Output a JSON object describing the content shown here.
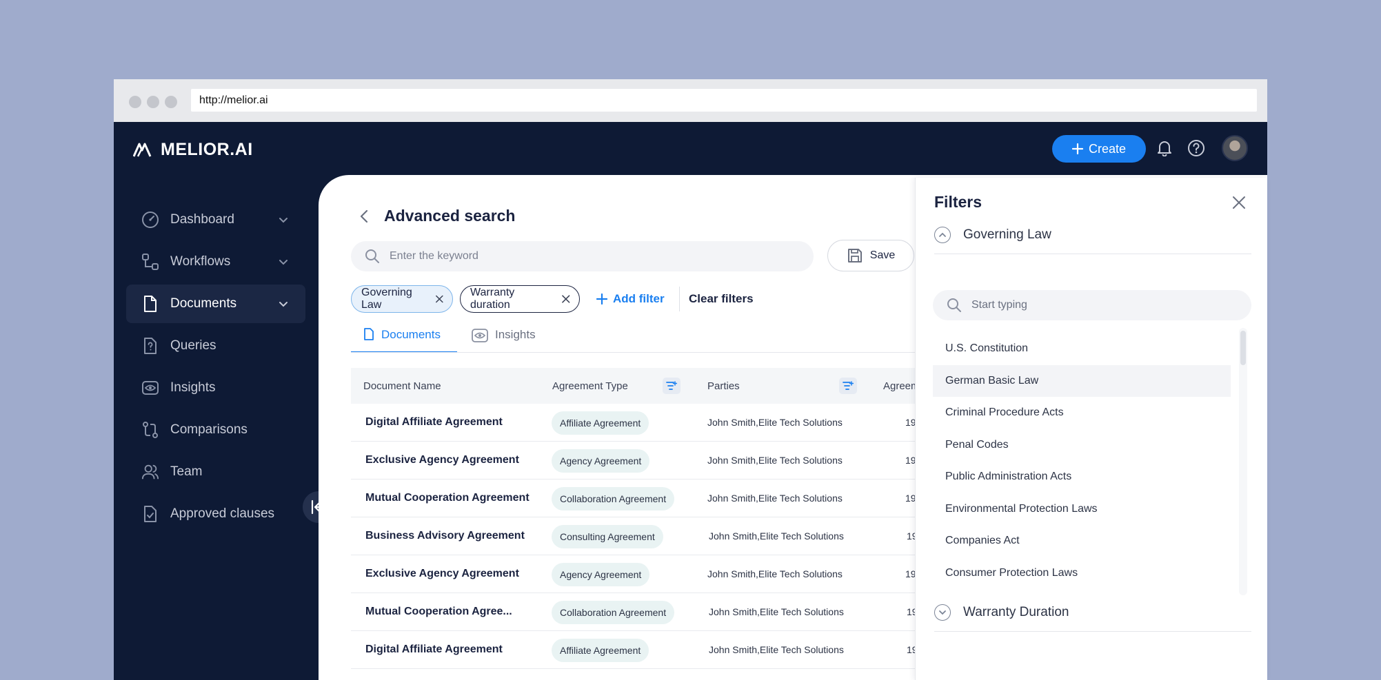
{
  "browser": {
    "url": "http://melior.ai"
  },
  "app": {
    "logo_text": "MELIOR.AI",
    "create_label": "Create"
  },
  "sidebar": {
    "items": [
      {
        "label": "Dashboard",
        "icon": "gauge-icon",
        "has_chevron": true
      },
      {
        "label": "Workflows",
        "icon": "workflow-icon",
        "has_chevron": true
      },
      {
        "label": "Documents",
        "icon": "document-icon",
        "has_chevron": true,
        "active": true
      },
      {
        "label": "Queries",
        "icon": "query-icon"
      },
      {
        "label": "Insights",
        "icon": "eye-icon"
      },
      {
        "label": "Comparisons",
        "icon": "compare-icon"
      },
      {
        "label": "Team",
        "icon": "team-icon"
      },
      {
        "label": "Approved clauses",
        "icon": "approved-doc-icon"
      }
    ]
  },
  "main": {
    "title": "Advanced search",
    "search_placeholder": "Enter the keyword",
    "save_label": "Save",
    "chips": [
      "Governing Law",
      "Warranty duration"
    ],
    "add_filter_label": "Add filter",
    "clear_filters_label": "Clear filters",
    "tabs": [
      {
        "label": "Documents",
        "active": true
      },
      {
        "label": "Insights",
        "active": false
      }
    ],
    "table": {
      "columns": [
        "Document Name",
        "Agreement Type",
        "Parties",
        "Agreem"
      ],
      "rows": [
        {
          "name": "Digital Affiliate Agreement",
          "type": "Affiliate Agreement",
          "parties": "John Smith,Elite Tech Solutions",
          "agree": "19"
        },
        {
          "name": "Exclusive Agency Agreement",
          "type": "Agency Agreement",
          "parties": "John Smith,Elite Tech Solutions",
          "agree": "19"
        },
        {
          "name": "Mutual Cooperation Agreement",
          "type": "Collaboration Agreement",
          "parties": "John Smith,Elite Tech Solutions",
          "agree": "19"
        },
        {
          "name": "Business Advisory Agreement",
          "type": "Consulting Agreement",
          "parties": "John Smith,Elite Tech Solutions",
          "agree": "19"
        },
        {
          "name": "Exclusive Agency Agreement",
          "type": "Agency Agreement",
          "parties": "John Smith,Elite Tech Solutions",
          "agree": "19"
        },
        {
          "name": "Mutual Cooperation Agree...",
          "type": "Collaboration Agreement",
          "parties": "John Smith,Elite Tech Solutions",
          "agree": "19"
        },
        {
          "name": "Digital Affiliate Agreement",
          "type": "Affiliate Agreement",
          "parties": "John Smith,Elite Tech Solutions",
          "agree": "19"
        }
      ]
    }
  },
  "filters_panel": {
    "title": "Filters",
    "governing_law_label": "Governing Law",
    "search_placeholder": "Start typing",
    "options": [
      "U.S. Constitution",
      "German Basic Law",
      "Criminal Procedure Acts",
      "Penal Codes",
      "Public Administration Acts",
      "Environmental Protection Laws",
      "Companies Act",
      "Consumer Protection Laws"
    ],
    "warranty_duration_label": "Warranty Duration"
  },
  "colors": {
    "page_bg": "#9fabcc",
    "app_bg": "#0e1a35",
    "accent": "#1a7ff0",
    "text_dark": "#1b2340"
  }
}
